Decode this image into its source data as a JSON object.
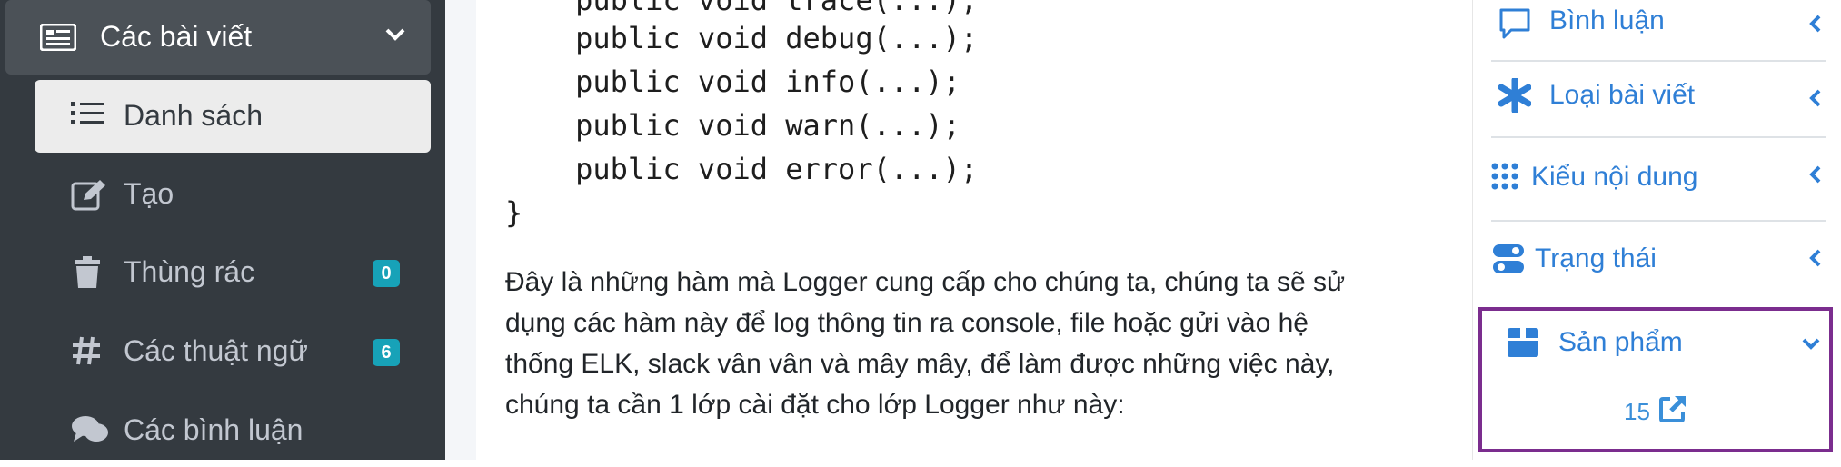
{
  "sidebar": {
    "parent": {
      "label": "Các bài viết",
      "icon": "newspaper-icon"
    },
    "items": [
      {
        "label": "Danh sách",
        "icon": "list-icon",
        "active": true
      },
      {
        "label": "Tạo",
        "icon": "edit-icon"
      },
      {
        "label": "Thùng rác",
        "icon": "trash-icon",
        "badge": "0"
      },
      {
        "label": "Các thuật ngữ",
        "icon": "hashtag-icon",
        "badge": "6"
      },
      {
        "label": "Các bình luận",
        "icon": "comments-icon"
      }
    ]
  },
  "main": {
    "code_lines": [
      "    public void trace(...);",
      "    public void debug(...);",
      "    public void info(...);",
      "    public void warn(...);",
      "    public void error(...);",
      "}"
    ],
    "paragraph_lines": [
      "Đây là những hàm mà Logger cung cấp cho chúng ta, chúng ta sẽ sử",
      "dụng các hàm này để log thông tin ra console, file hoặc gửi vào hệ",
      "thống ELK, slack vân vân và mây mây, để làm được những việc này,",
      "chúng ta cần 1 lớp cài đặt cho lớp Logger như này:"
    ]
  },
  "right_sidebar": {
    "items": [
      {
        "label": "Bình luận",
        "icon": "comment-icon"
      },
      {
        "label": "Loại bài viết",
        "icon": "asterisk-icon"
      },
      {
        "label": "Kiểu nội dung",
        "icon": "grid-icon"
      },
      {
        "label": "Trạng thái",
        "icon": "toggle-icon"
      }
    ],
    "products": {
      "label": "Sản phẩm",
      "icon": "box-icon",
      "count": "15"
    }
  },
  "colors": {
    "sidebar_bg": "#343a40",
    "accent_blue": "#2f7fd6",
    "badge_teal": "#17a2b8",
    "highlight_border": "#7b2d8e"
  }
}
